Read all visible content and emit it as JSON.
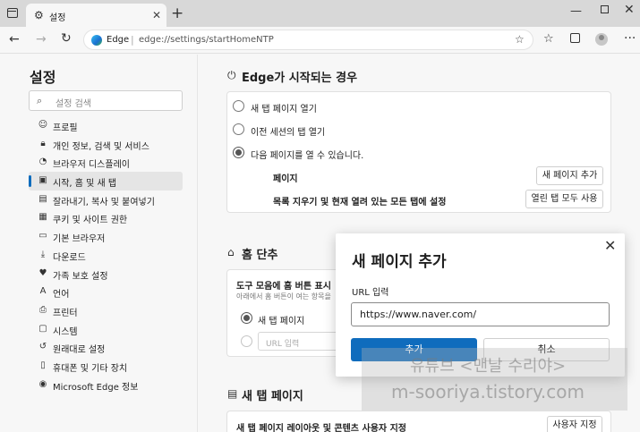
{
  "browser": {
    "tab_title": "설정",
    "site_name": "Edge",
    "url": "edge://settings/startHomeNTP"
  },
  "sidebar": {
    "title": "설정",
    "search_placeholder": "설정 검색",
    "items": [
      {
        "label": "프로필",
        "icon": "person-icon"
      },
      {
        "label": "개인 정보, 검색 및 서비스",
        "icon": "lock-icon"
      },
      {
        "label": "브라우저 디스플레이",
        "icon": "palette-icon"
      },
      {
        "label": "시작, 홈 및 새 탭",
        "icon": "home-tab-icon",
        "active": true
      },
      {
        "label": "잘라내기, 복사 및 붙여넣기",
        "icon": "clipboard-icon"
      },
      {
        "label": "쿠키 및 사이트 권한",
        "icon": "cookie-icon"
      },
      {
        "label": "기본 브라우저",
        "icon": "browser-icon"
      },
      {
        "label": "다운로드",
        "icon": "download-icon"
      },
      {
        "label": "가족 보호 설정",
        "icon": "family-icon"
      },
      {
        "label": "언어",
        "icon": "language-icon"
      },
      {
        "label": "프린터",
        "icon": "printer-icon"
      },
      {
        "label": "시스템",
        "icon": "system-icon"
      },
      {
        "label": "원래대로 설정",
        "icon": "reset-icon"
      },
      {
        "label": "휴대폰 및 기타 장치",
        "icon": "phone-icon"
      },
      {
        "label": "Microsoft Edge 정보",
        "icon": "edge-icon"
      }
    ]
  },
  "startup": {
    "title": "Edge가 시작되는 경우",
    "options": [
      "새 탭 페이지 열기",
      "이전 세션의 탭 열기",
      "다음 페이지를 열 수 있습니다."
    ],
    "selected": 2,
    "pages_label": "페이지",
    "add_page_button": "새 페이지 추가",
    "clear_label": "목록 지우기 및 현재 열려 있는 모든 탭에 설정",
    "use_all_tabs_button": "열린 탭 모두 사용"
  },
  "home": {
    "title": "홈 단추",
    "toolbar_label": "도구 모음에 홈 버튼 표시",
    "toolbar_sub": "아래에서 홈 버튼이 여는 항목을",
    "option_new_tab": "새 탭 페이지",
    "url_placeholder": "URL 입력"
  },
  "newtab": {
    "title": "새 탭 페이지",
    "customize_label": "새 탭 페이지 레이아웃 및 콘텐츠 사용자 지정",
    "customize_button": "사용자 지정"
  },
  "dialog": {
    "title": "새 페이지 추가",
    "field_label": "URL 입력",
    "field_value": "https://www.naver.com/",
    "add_button": "추가",
    "cancel_button": "취소"
  },
  "watermark": {
    "line1": "유튜브 <맨날 수리야>",
    "line2": "m-sooriya.tistory.com"
  },
  "colors": {
    "accent": "#0f6cbd",
    "background": "#f7f7f7"
  }
}
